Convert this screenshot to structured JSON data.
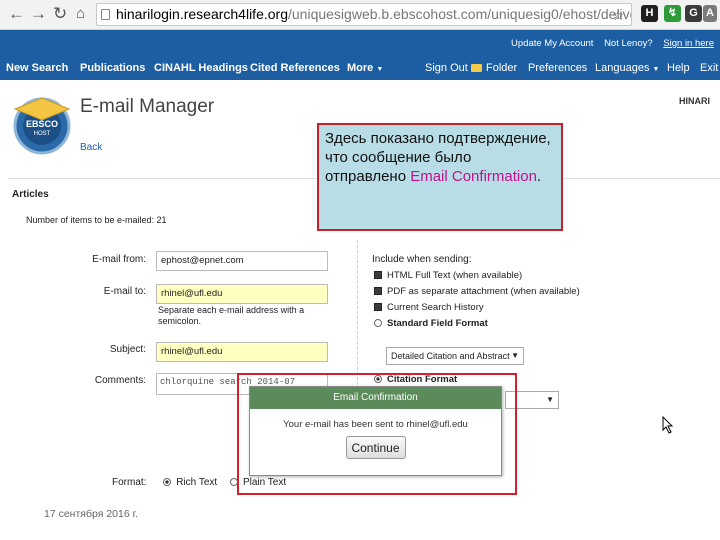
{
  "browser": {
    "url_host": "hinarilogin.research4life.org",
    "url_path": "/uniquesigweb.b.ebscohost.com/uniquesig0/ehost/delive",
    "extensions": [
      {
        "glyph": "H",
        "color": "#1f1f1f"
      },
      {
        "glyph": "↯",
        "color": "#2e9a3a"
      },
      {
        "glyph": "G",
        "color": "#3a3a3a"
      },
      {
        "glyph": "a",
        "color": "#e0523e"
      },
      {
        "glyph": "A",
        "color": "#7a7a7a"
      }
    ]
  },
  "topbar": {
    "update_account": "Update My Account",
    "not_user": "Not Lenoy?",
    "sign_in": "Sign in here"
  },
  "nav": {
    "new_search": "New Search",
    "publications": "Publications",
    "cinahl_headings": "CINAHL Headings",
    "cited_references": "Cited References",
    "more": "More",
    "sign_out": "Sign Out",
    "folder": "Folder",
    "preferences": "Preferences",
    "languages": "Languages",
    "help": "Help",
    "exit": "Exit"
  },
  "header": {
    "logo_top": "EBSCO",
    "logo_bottom": "HOST",
    "title": "E-mail Manager",
    "back": "Back",
    "institution": "HINARI"
  },
  "section": {
    "title": "Articles",
    "count_text": "Number of items to be e-mailed: 21"
  },
  "form": {
    "from_label": "E-mail from:",
    "from_value": "ephost@epnet.com",
    "to_label": "E-mail to:",
    "to_value": "rhinel@ufl.edu",
    "to_hint": "Separate each e-mail address with a semicolon.",
    "subject_label": "Subject:",
    "subject_value": "rhinel@ufl.edu",
    "comments_label": "Comments:",
    "comments_value": "chlorquine search 2014-07",
    "format_label": "Format:",
    "format_rich": "Rich Text",
    "format_plain": "Plain Text"
  },
  "include": {
    "title": "Include when sending:",
    "html": "HTML Full Text (when available)",
    "pdf": "PDF as separate attachment (when available)",
    "history": "Current Search History",
    "standard": "Standard Field Format",
    "standard_select": "Detailed Citation and Abstract",
    "citation": "Citation Format"
  },
  "modal": {
    "title": "Email Confirmation",
    "message": "Your e-mail has been sent to rhinel@ufl.edu",
    "button": "Continue"
  },
  "callout": {
    "text_before": "Здесь показано подтверждение, что сообщение было отправлено ",
    "highlight": "Email Confirmation",
    "text_after": "."
  },
  "footer": {
    "date": "17 сентября 2016 г."
  }
}
